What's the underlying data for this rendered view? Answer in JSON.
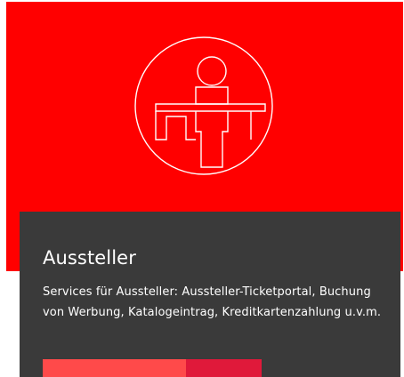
{
  "colors": {
    "hero_background": "#ff0000",
    "card_background": "#3a3a3a",
    "button_primary": "#ff4a4a",
    "button_secondary": "#e0193a",
    "text": "#ffffff"
  },
  "hero": {
    "icon": "exhibitor-booth-icon"
  },
  "card": {
    "title": "Aussteller",
    "description": "Services für Aussteller: Aussteller-Ticketportal, Buchung von Werbung, Katalogeintrag, Kreditkartenzahlung u.v.m."
  }
}
